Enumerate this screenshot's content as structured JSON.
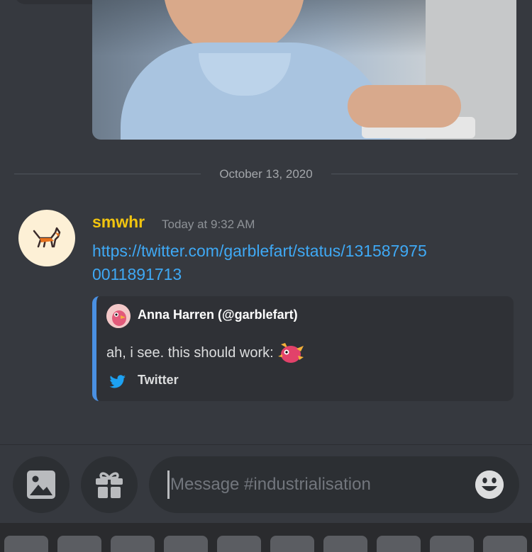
{
  "date_divider": "October 13, 2020",
  "message": {
    "username": "smwhr",
    "timestamp": "Today at 9:32 AM",
    "link": "https://twitter.com/garblefart/status/1315879750011891713",
    "username_color": "#f1c40f",
    "link_color": "#3fa9f5"
  },
  "embed": {
    "author": "Anna Harren (@garblefart)",
    "description": "ah, i see. this should work:",
    "footer": "Twitter",
    "accent_color": "#4a90e2"
  },
  "composer": {
    "placeholder": "Message #industrialisation",
    "left_buttons": [
      "image-icon",
      "gift-icon"
    ],
    "right_button": "emoji-icon"
  },
  "keyboard_keys": 10
}
